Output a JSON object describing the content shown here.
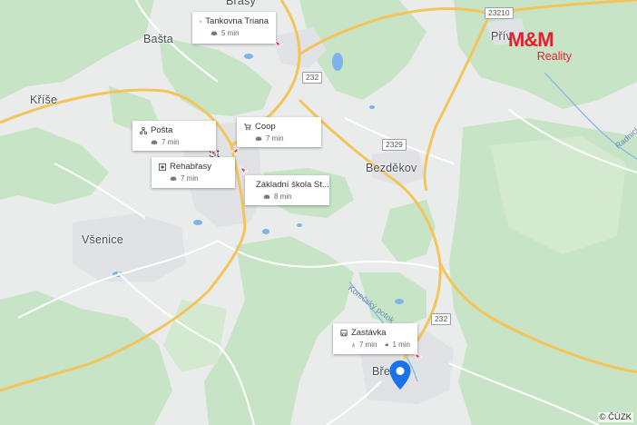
{
  "places": {
    "brasy": "Brasy",
    "basta": "Bašta",
    "krise": "Kříše",
    "stupno": "St",
    "vsenice": "Všenice",
    "bezdekov": "Bezděkov",
    "privetice": "Přív",
    "brezina": "Břez"
  },
  "roads": {
    "r232_a": "232",
    "r232_b": "232",
    "r2329": "2329",
    "r23210": "23210"
  },
  "river_labels": {
    "korecky_potok": "Korečský potok",
    "radnicky": "Radnick"
  },
  "pois": [
    {
      "name": "Tankovna Triana",
      "icon": "restaurant-icon",
      "car_time": "5 min"
    },
    {
      "name": "Pošta",
      "icon": "post-icon",
      "car_time": "7 min"
    },
    {
      "name": "Coop",
      "icon": "shopping-cart-icon",
      "car_time": "7 min"
    },
    {
      "name": "Rehabřasy",
      "icon": "medical-icon",
      "car_time": "7 min"
    },
    {
      "name": "Základní škola St...",
      "icon": "school-icon",
      "car_time": "8 min"
    },
    {
      "name": "Zastávka",
      "icon": "bus-icon",
      "walk_time": "7 min",
      "car_time": "1 min"
    }
  ],
  "logo": {
    "mark": "M&M",
    "text": "Reality",
    "color": "#e5202e"
  },
  "copyright": "© ČÚZK",
  "colors": {
    "forest": "#c6e3c4",
    "land": "#e9ecea",
    "road": "#f5c451",
    "water": "#6fa8e6",
    "marker": "#1a73e8"
  }
}
